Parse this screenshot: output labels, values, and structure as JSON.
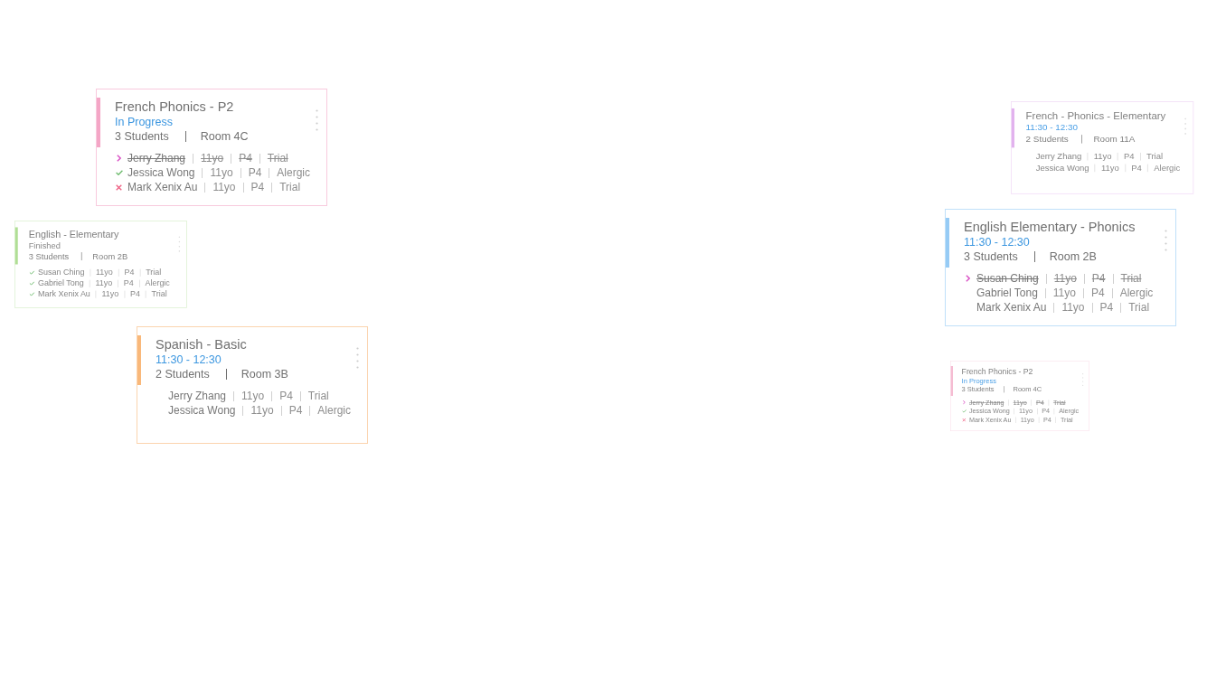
{
  "cards": [
    {
      "title": "French Phonics - P2",
      "color": "#f4a6c6",
      "faded": false,
      "subtitle": {
        "kind": "progress",
        "text": "In Progress"
      },
      "students_count": "3 Students",
      "room": "Room 4C",
      "students": [
        {
          "name": "Jerry Zhang",
          "kind": "current",
          "age": "11yo",
          "grade": "P4",
          "note": "Trial"
        },
        {
          "name": "Jessica Wong",
          "kind": "present",
          "age": "11yo",
          "grade": "P4",
          "note": "Alergic"
        },
        {
          "name": "Mark Xenix Au",
          "kind": "absent",
          "age": "11yo",
          "grade": "P4",
          "note": "Trial"
        }
      ]
    },
    {
      "title": "English - Elementary",
      "color": "#b0de95",
      "faded": true,
      "subtitle": {
        "kind": "finished",
        "text": "Finished"
      },
      "students_count": "3 Students",
      "room": "Room 2B",
      "students": [
        {
          "name": "Susan Ching",
          "kind": "present",
          "age": "11yo",
          "grade": "P4",
          "note": "Trial"
        },
        {
          "name": "Gabriel Tong",
          "kind": "present",
          "age": "11yo",
          "grade": "P4",
          "note": "Alergic"
        },
        {
          "name": "Mark Xenix Au",
          "kind": "present",
          "age": "11yo",
          "grade": "P4",
          "note": "Trial"
        }
      ]
    },
    {
      "title": "Spanish - Basic",
      "color": "#f9b87a",
      "faded": false,
      "subtitle": {
        "kind": "time",
        "text": "11:30 - 12:30"
      },
      "students_count": "2 Students",
      "room": "Room 3B",
      "students": [
        {
          "name": "Jerry Zhang",
          "kind": "plain",
          "age": "11yo",
          "grade": "P4",
          "note": "Trial"
        },
        {
          "name": "Jessica Wong",
          "kind": "plain",
          "age": "11yo",
          "grade": "P4",
          "note": "Alergic"
        }
      ]
    },
    {
      "title": "French - Phonics - Elementary",
      "color": "#e2b2ee",
      "faded": true,
      "subtitle": {
        "kind": "time",
        "text": "11:30 - 12:30"
      },
      "students_count": "2 Students",
      "room": "Room 11A",
      "students": [
        {
          "name": "Jerry Zhang",
          "kind": "plain",
          "age": "11yo",
          "grade": "P4",
          "note": "Trial"
        },
        {
          "name": "Jessica Wong",
          "kind": "plain",
          "age": "11yo",
          "grade": "P4",
          "note": "Alergic"
        }
      ]
    },
    {
      "title": "English Elementary - Phonics",
      "color": "#96cbf5",
      "faded": false,
      "subtitle": {
        "kind": "time",
        "text": "11:30 - 12:30"
      },
      "students_count": "3 Students",
      "room": "Room 2B",
      "students": [
        {
          "name": "Susan Ching",
          "kind": "current",
          "age": "11yo",
          "grade": "P4",
          "note": "Trial"
        },
        {
          "name": "Gabriel Tong",
          "kind": "plain",
          "age": "11yo",
          "grade": "P4",
          "note": "Alergic"
        },
        {
          "name": "Mark Xenix Au",
          "kind": "plain",
          "age": "11yo",
          "grade": "P4",
          "note": "Trial"
        }
      ]
    },
    {
      "title": "French Phonics - P2",
      "color": "#f5bcd2",
      "faded": true,
      "subtitle": {
        "kind": "progress",
        "text": "In Progress"
      },
      "students_count": "3 Students",
      "room": "Room 4C",
      "students": [
        {
          "name": "Jerry Zhang",
          "kind": "current",
          "age": "11yo",
          "grade": "P4",
          "note": "Trial"
        },
        {
          "name": "Jessica Wong",
          "kind": "present",
          "age": "11yo",
          "grade": "P4",
          "note": "Alergic"
        },
        {
          "name": "Mark Xenix Au",
          "kind": "absent",
          "age": "11yo",
          "grade": "P4",
          "note": "Trial"
        }
      ]
    }
  ]
}
